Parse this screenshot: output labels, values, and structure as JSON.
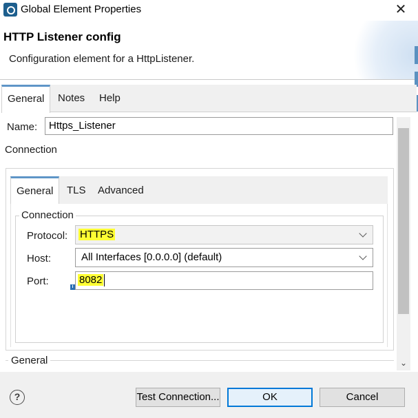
{
  "window": {
    "title": "Global Element Properties",
    "close_glyph": "✕"
  },
  "header": {
    "title": "HTTP Listener config",
    "description": "Configuration element for a HttpListener."
  },
  "main_tabs": [
    {
      "label": "General",
      "active": true
    },
    {
      "label": "Notes",
      "active": false
    },
    {
      "label": "Help",
      "active": false
    }
  ],
  "name_field": {
    "label": "Name:",
    "value": "Https_Listener"
  },
  "connection_section_label": "Connection",
  "inner_tabs": [
    {
      "label": "General",
      "active": true
    },
    {
      "label": "TLS",
      "active": false
    },
    {
      "label": "Advanced",
      "active": false
    }
  ],
  "connection_group": {
    "legend": "Connection",
    "protocol": {
      "label": "Protocol:",
      "value": "HTTPS",
      "highlighted": true
    },
    "host": {
      "label": "Host:",
      "value": "All Interfaces [0.0.0.0] (default)"
    },
    "port": {
      "label": "Port:",
      "value": "8082",
      "highlighted": true,
      "info_glyph": "i"
    }
  },
  "general_section_label": "General",
  "footer": {
    "help_glyph": "?",
    "test_connection_label": "Test Connection...",
    "ok_label": "OK",
    "cancel_label": "Cancel"
  },
  "colors": {
    "tab_accent": "#5e95c7",
    "highlight": "#ffff33",
    "default_button_border": "#0078d7"
  }
}
